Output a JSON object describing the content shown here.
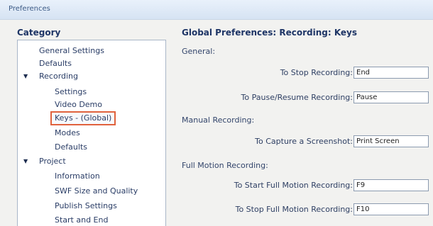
{
  "window": {
    "title": "Preferences"
  },
  "category": {
    "label": "Category",
    "items": [
      {
        "label": "General Settings",
        "level": 0
      },
      {
        "label": "Defaults",
        "level": 0
      },
      {
        "label": "Recording",
        "level": 0,
        "expanded": true
      },
      {
        "label": "Settings",
        "level": 1
      },
      {
        "label": "Video Demo",
        "level": 1
      },
      {
        "label": "Keys - (Global)",
        "level": 1,
        "selected": true
      },
      {
        "label": "Modes",
        "level": 1
      },
      {
        "label": "Defaults",
        "level": 1
      },
      {
        "label": "Project",
        "level": 0,
        "expanded": true
      },
      {
        "label": "Information",
        "level": 1
      },
      {
        "label": "SWF Size and Quality",
        "level": 1
      },
      {
        "label": "Publish Settings",
        "level": 1
      },
      {
        "label": "Start and End",
        "level": 1
      }
    ]
  },
  "main": {
    "heading": "Global Preferences: Recording: Keys",
    "general": {
      "label": "General:",
      "stop_label": "To Stop Recording:",
      "stop_value": "End",
      "pause_label": "To Pause/Resume Recording:",
      "pause_value": "Pause"
    },
    "manual": {
      "label": "Manual Recording:",
      "capture_label": "To Capture a Screenshot:",
      "capture_value": "Print Screen"
    },
    "full_motion": {
      "label": "Full Motion Recording:",
      "start_label": "To Start Full Motion Recording:",
      "start_value": "F9",
      "stop_label": "To Stop Full Motion Recording:",
      "stop_value": "F10"
    }
  },
  "colors": {
    "selection_outline": "#e0623d",
    "title_gradient_top": "#e9f1fb",
    "title_gradient_bottom": "#d6e3f3"
  },
  "icons": {
    "expand": "expanded-arrow-icon"
  }
}
